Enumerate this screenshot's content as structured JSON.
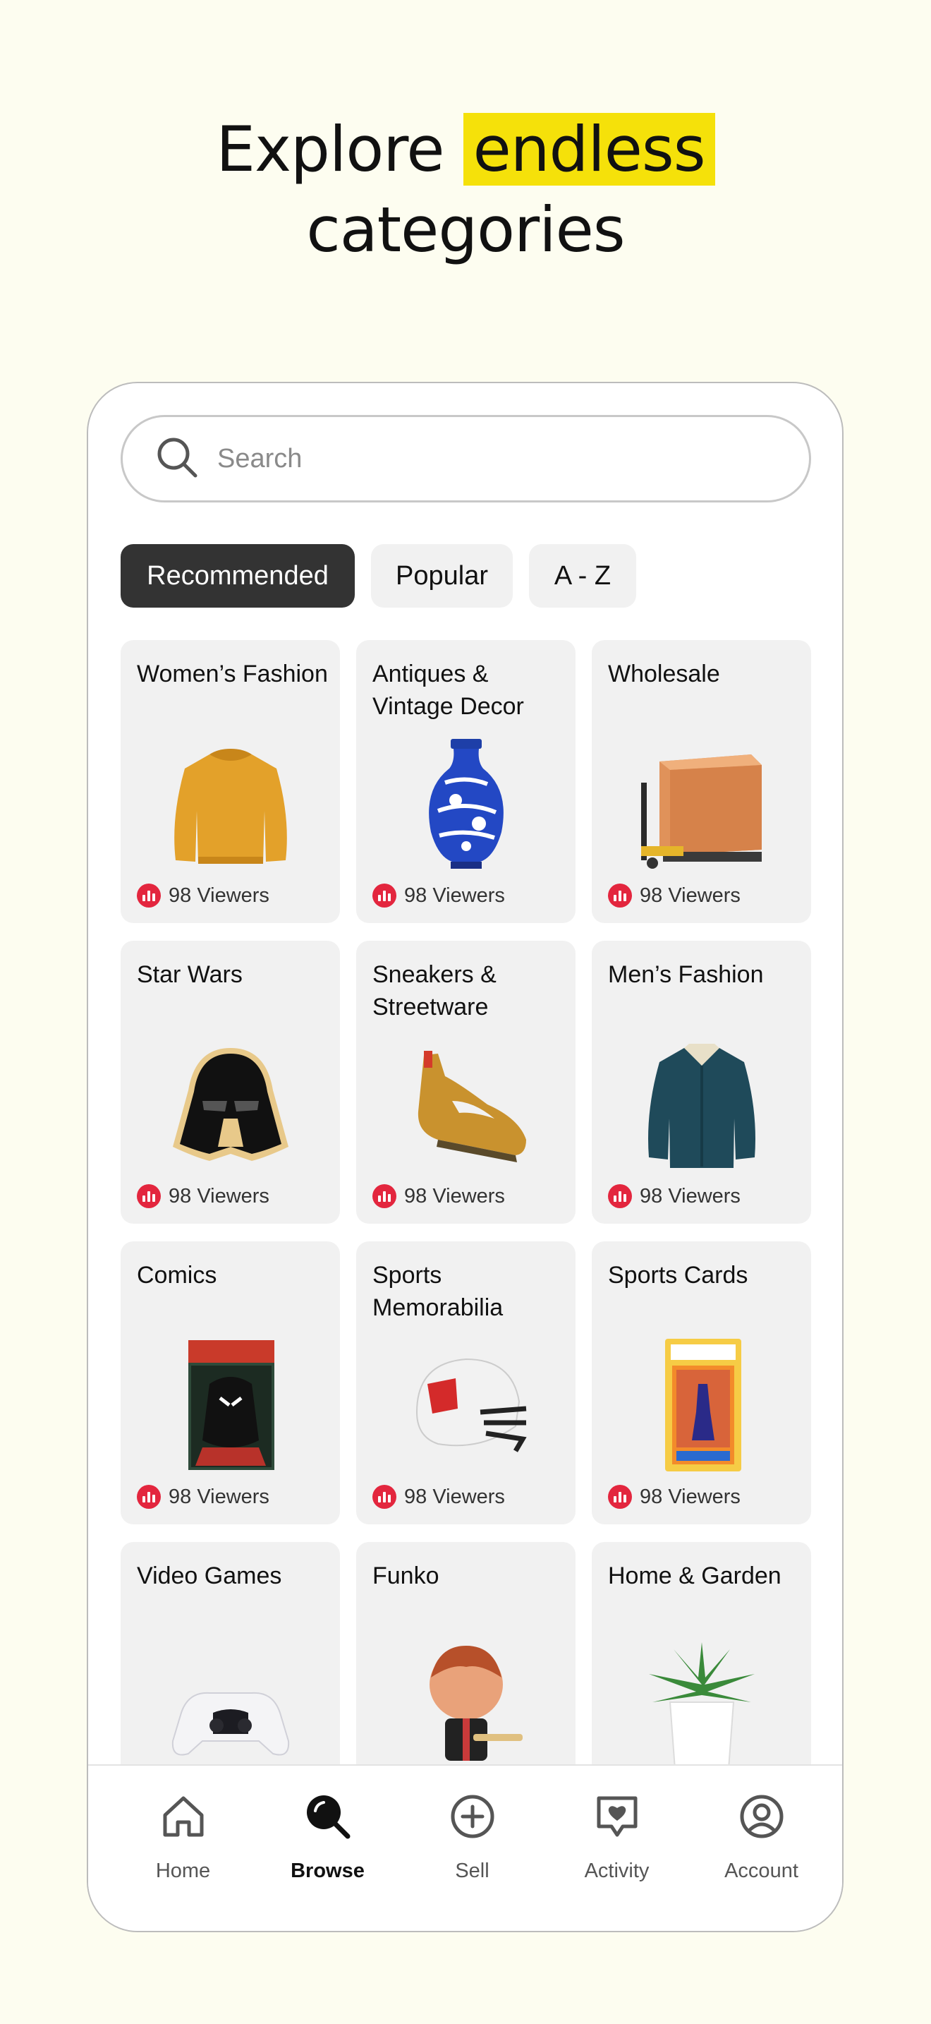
{
  "headline": {
    "line1_prefix": "Explore",
    "highlight": "endless",
    "line2": "categories",
    "highlight_color": "#f5e10a"
  },
  "search": {
    "placeholder": "Search",
    "icon": "search-icon"
  },
  "tabs": [
    {
      "label": "Recommended",
      "active": true
    },
    {
      "label": "Popular",
      "active": false
    },
    {
      "label": "A - Z",
      "active": false
    }
  ],
  "categories": [
    {
      "title": "Women’s Fashion",
      "viewers": "98 Viewers",
      "image": "sweater-image"
    },
    {
      "title": "Antiques & Vintage Decor",
      "viewers": "98 Viewers",
      "image": "vase-image"
    },
    {
      "title": "Wholesale",
      "viewers": "98 Viewers",
      "image": "pallet-image"
    },
    {
      "title": "Star Wars",
      "viewers": "98 Viewers",
      "image": "helmet-pin-image"
    },
    {
      "title": "Sneakers & Streetware",
      "viewers": "98 Viewers",
      "image": "sneaker-image"
    },
    {
      "title": "Men’s Fashion",
      "viewers": "98 Viewers",
      "image": "jacket-image"
    },
    {
      "title": "Comics",
      "viewers": "98 Viewers",
      "image": "comic-book-image"
    },
    {
      "title": "Sports Memorabilia",
      "viewers": "98 Viewers",
      "image": "football-helmet-image"
    },
    {
      "title": "Sports Cards",
      "viewers": "98 Viewers",
      "image": "graded-card-image"
    },
    {
      "title": "Video Games",
      "viewers": "",
      "image": "controller-image"
    },
    {
      "title": "Funko",
      "viewers": "",
      "image": "figure-image"
    },
    {
      "title": "Home & Garden",
      "viewers": "",
      "image": "plant-image"
    }
  ],
  "nav": [
    {
      "label": "Home",
      "icon": "home-icon",
      "active": false
    },
    {
      "label": "Browse",
      "icon": "browse-icon",
      "active": true
    },
    {
      "label": "Sell",
      "icon": "plus-circle-icon",
      "active": false
    },
    {
      "label": "Activity",
      "icon": "heart-chat-icon",
      "active": false
    },
    {
      "label": "Account",
      "icon": "account-icon",
      "active": false
    }
  ],
  "colors": {
    "background": "#fdfdf0",
    "accent_highlight": "#f5e10a",
    "live_red": "#e3263e",
    "active_tab": "#333333",
    "card_bg": "#f1f1f1"
  }
}
